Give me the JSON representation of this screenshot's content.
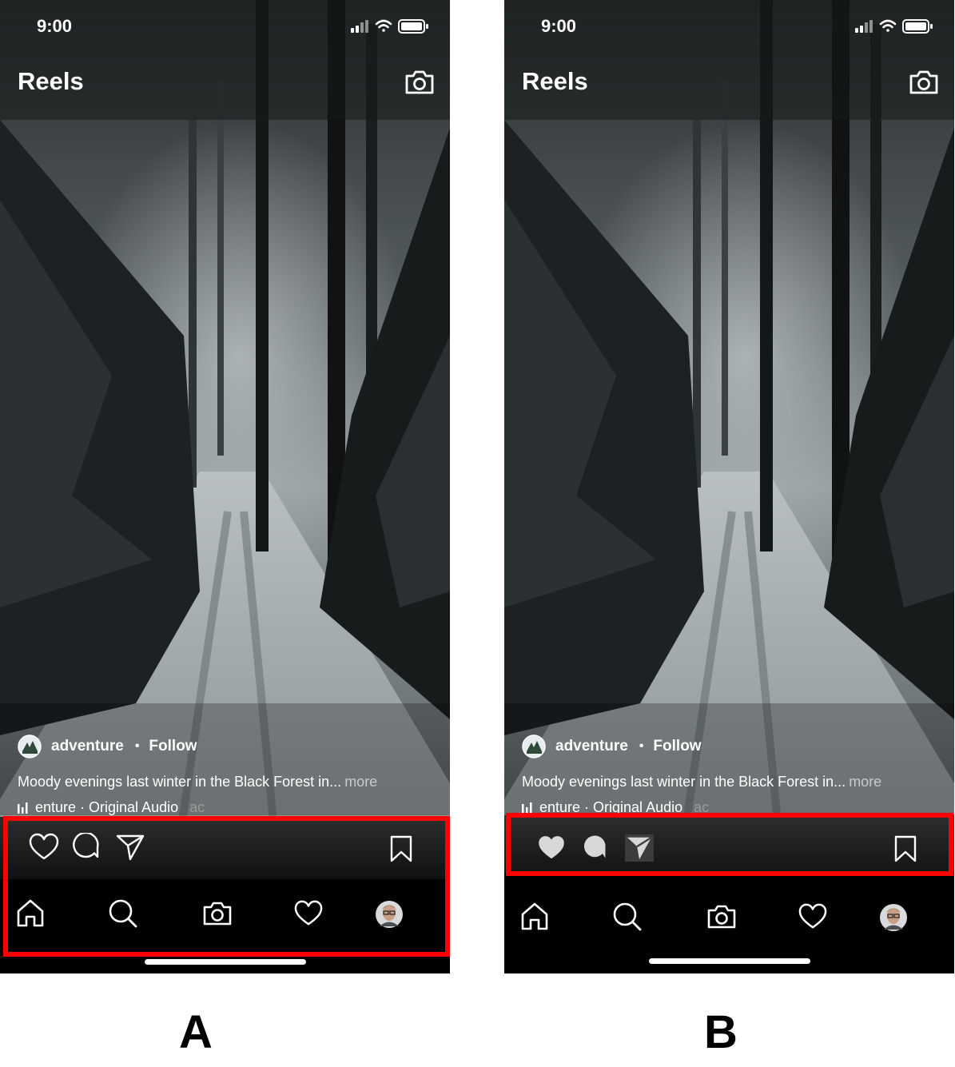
{
  "panels": [
    {
      "label": "A",
      "status_time": "9:00",
      "screen_title": "Reels",
      "author": {
        "name": "adventure",
        "separator": "•",
        "follow": "Follow"
      },
      "caption": {
        "text": "Moody evenings last winter in the Black Forest in...",
        "more": "more"
      },
      "audio": {
        "text": "enture · Original Audio",
        "trailing": "ac"
      },
      "action_style": "outline"
    },
    {
      "label": "B",
      "status_time": "9:00",
      "screen_title": "Reels",
      "author": {
        "name": "adventure",
        "separator": "•",
        "follow": "Follow"
      },
      "caption": {
        "text": "Moody evenings last winter in the Black Forest in...",
        "more": "more"
      },
      "audio": {
        "text": "enture · Original Audio",
        "trailing": "ac"
      },
      "action_style": "filled"
    }
  ],
  "icons": {
    "status": [
      "cellular-signal-icon",
      "wifi-icon",
      "battery-icon"
    ],
    "header": [
      "camera-icon"
    ],
    "actions": [
      "heart-icon",
      "comment-icon",
      "share-icon",
      "bookmark-icon"
    ],
    "nav": [
      "home-icon",
      "search-icon",
      "camera-icon",
      "heart-icon",
      "profile-avatar"
    ]
  },
  "colors": {
    "highlight": "#ff0000",
    "text": "#ffffff",
    "nav_background": "#000000"
  }
}
